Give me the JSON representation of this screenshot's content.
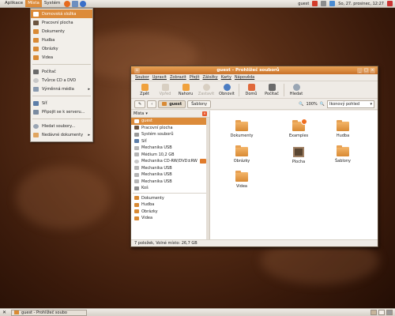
{
  "top_panel": {
    "menus": [
      "Aplikace",
      "Místa",
      "Systém"
    ],
    "user": "guest",
    "clock": "So, 27. prosinec, 12:27"
  },
  "places_menu": {
    "items": [
      {
        "label": "Domovská složka",
        "icon": "home-folder-icon",
        "active": true
      },
      {
        "label": "Pracovní plocha",
        "icon": "desktop-icon"
      },
      {
        "label": "Dokumenty",
        "icon": "folder-icon"
      },
      {
        "label": "Hudba",
        "icon": "folder-icon"
      },
      {
        "label": "Obrázky",
        "icon": "folder-icon"
      },
      {
        "label": "Videa",
        "icon": "folder-icon"
      },
      {
        "label": "Počítač",
        "icon": "computer-icon"
      },
      {
        "label": "Tvůrce CD a DVD",
        "icon": "cd-burner-icon"
      },
      {
        "label": "Výměnná média",
        "icon": "removable-media-icon",
        "submenu": true
      },
      {
        "label": "Síť",
        "icon": "network-icon"
      },
      {
        "label": "Připojit se k serveru...",
        "icon": "server-icon"
      },
      {
        "label": "Hledat soubory...",
        "icon": "search-icon"
      },
      {
        "label": "Nedávné dokumenty",
        "icon": "recent-documents-icon",
        "submenu": true
      }
    ]
  },
  "window": {
    "title": "guest - Prohlížeč souborů",
    "menubar": [
      "Soubor",
      "Upravit",
      "Zobrazit",
      "Přejít",
      "Záložky",
      "Karty",
      "Nápověda"
    ],
    "toolbar": [
      {
        "label": "Zpět",
        "icon": "back-arrow-icon",
        "enabled": true
      },
      {
        "label": "Vpřed",
        "icon": "forward-arrow-icon",
        "enabled": false
      },
      {
        "label": "Nahoru",
        "icon": "up-arrow-icon",
        "enabled": true
      },
      {
        "label": "Zastavit",
        "icon": "stop-icon",
        "enabled": false
      },
      {
        "label": "Obnovit",
        "icon": "reload-icon",
        "enabled": true
      },
      {
        "label": "Domů",
        "icon": "home-icon",
        "enabled": true
      },
      {
        "label": "Počítač",
        "icon": "computer-icon",
        "enabled": true
      },
      {
        "label": "Hledat",
        "icon": "search-icon",
        "enabled": true
      }
    ],
    "location": {
      "path": [
        "guest",
        "Šablony"
      ],
      "zoom": "100%",
      "view": "Ikonový pohled"
    },
    "sidebar": {
      "title": "Místa",
      "items": [
        {
          "label": "guest",
          "selected": true
        },
        {
          "label": "Pracovní plocha"
        },
        {
          "label": "Systém souborů"
        },
        {
          "label": "Síť"
        },
        {
          "label": "Mechanika USB"
        },
        {
          "label": "Médium 10,2 GB"
        },
        {
          "label": "Mechanika CD-RW/DVD±RW",
          "eject": true
        },
        {
          "label": "Mechanika USB"
        },
        {
          "label": "Mechanika USB"
        },
        {
          "label": "Mechanika USB"
        },
        {
          "label": "Koš"
        },
        {
          "label": "Dokumenty"
        },
        {
          "label": "Hudba"
        },
        {
          "label": "Obrázky"
        },
        {
          "label": "Videa"
        }
      ]
    },
    "files": [
      {
        "label": "Dokumenty",
        "type": "folder"
      },
      {
        "label": "Examples",
        "type": "folder-link"
      },
      {
        "label": "Hudba",
        "type": "folder"
      },
      {
        "label": "Obrázky",
        "type": "folder"
      },
      {
        "label": "Plocha",
        "type": "desktop"
      },
      {
        "label": "Šablony",
        "type": "folder"
      },
      {
        "label": "Videa",
        "type": "folder"
      }
    ],
    "status": "7 položek, Volné místo: 26,7 GB"
  },
  "bottom_panel": {
    "task": "guest - Prohlížeč soubo"
  },
  "colors": {
    "accent": "#dc8b3a",
    "titlebar": "#c9722a",
    "panel": "#e3ded7"
  }
}
